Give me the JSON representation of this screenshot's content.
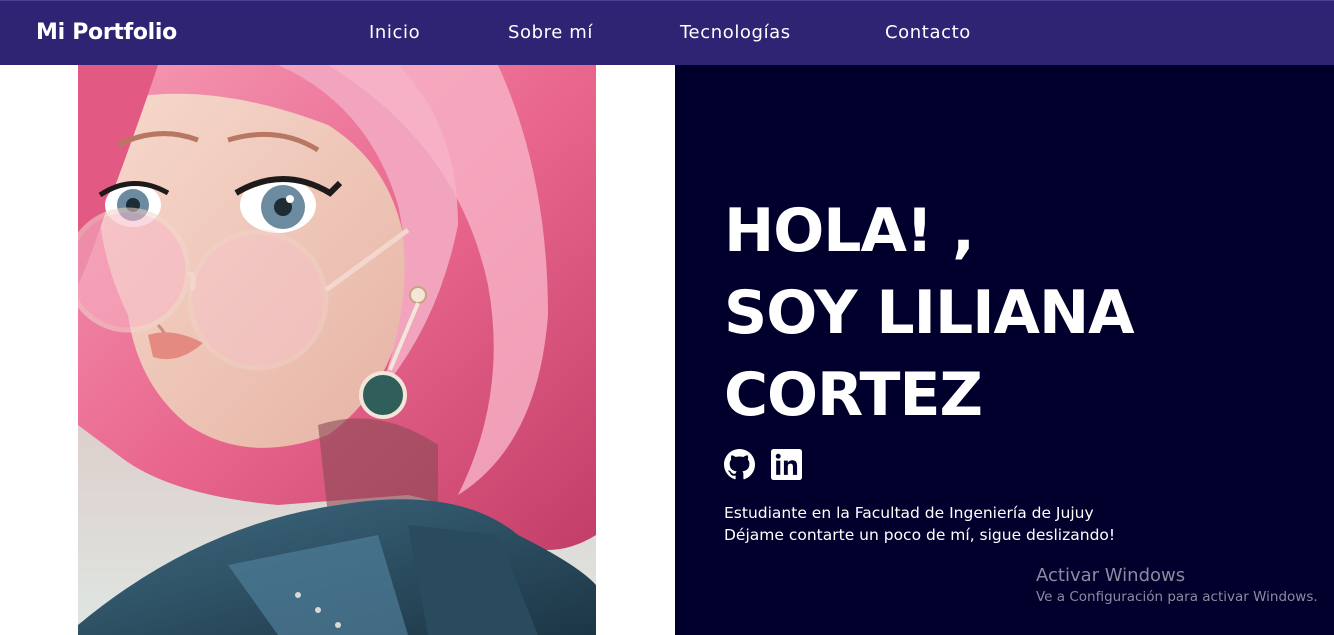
{
  "nav": {
    "brand": "Mi Portfolio",
    "links": [
      "Inicio",
      "Sobre mí",
      "Tecnologías",
      "Contacto"
    ]
  },
  "hero": {
    "headline": [
      "HOLA! ,",
      "SOY LILIANA",
      "CORTEZ"
    ],
    "social": [
      "github-icon",
      "linkedin-icon"
    ],
    "intro": [
      "Estudiante en la Facultad de Ingeniería de Jujuy",
      "Déjame contarte un poco de mí, sigue deslizando!"
    ]
  },
  "watermark": {
    "title": "Activar Windows",
    "subtitle": "Ve a Configuración para activar Windows."
  },
  "colors": {
    "navbar": "#2f2473",
    "hero_background": "#01002c",
    "text": "#ffffff",
    "hair_pink": "#e96a8f"
  }
}
